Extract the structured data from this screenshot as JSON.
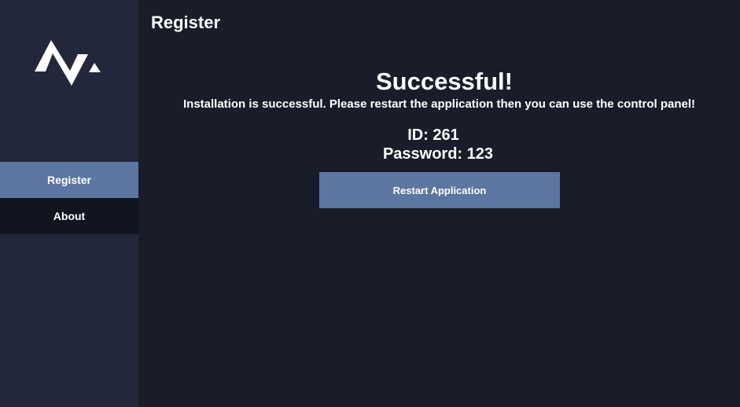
{
  "sidebar": {
    "logo_icon": "brand-logo-icon",
    "items": [
      {
        "label": "Register",
        "active": true
      },
      {
        "label": "About",
        "active": false
      }
    ]
  },
  "header": {
    "title": "Register"
  },
  "main": {
    "heading": "Successful!",
    "message": "Installation is successful. Please restart the application then you can use the control panel!",
    "id_line": "ID: 261",
    "password_line": "Password: 123",
    "restart_label": "Restart Application"
  },
  "colors": {
    "background": "#191d29",
    "sidebar": "#222839",
    "accent": "#5c76a1",
    "nav_inactive": "#111520",
    "text": "#ffffff"
  }
}
